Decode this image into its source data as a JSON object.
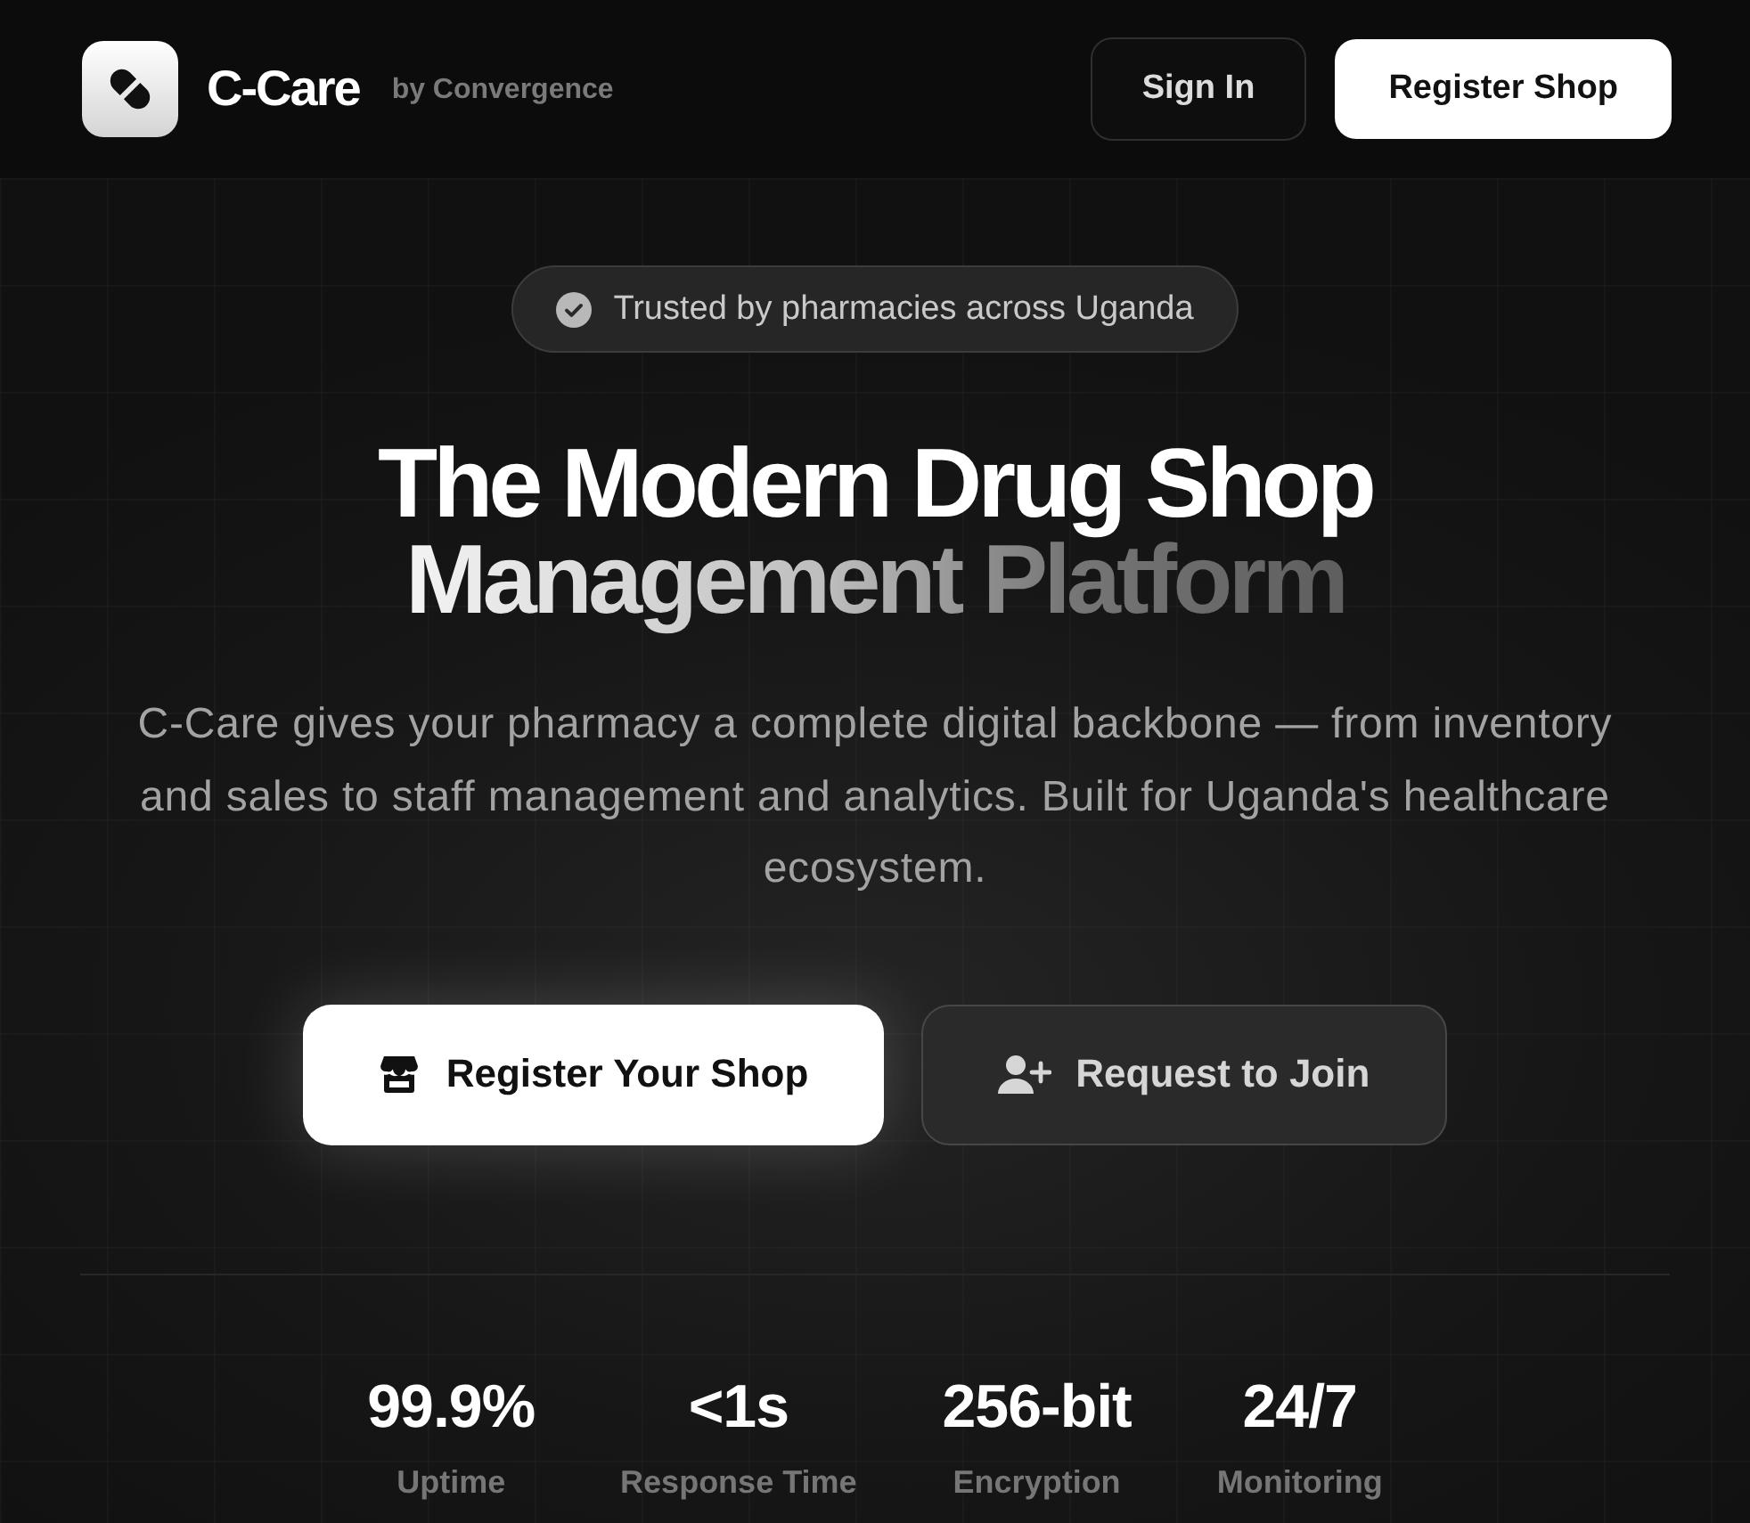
{
  "header": {
    "brand": {
      "name": "C-Care",
      "tagline": "by Convergence"
    },
    "buttons": [
      {
        "label": "Sign In",
        "kind": "outline"
      },
      {
        "label": "Register Shop",
        "kind": "primary"
      }
    ]
  },
  "hero": {
    "badge": "Trusted by pharmacies across Uganda",
    "headline": [
      "The Modern Drug Shop",
      "Management Platform"
    ],
    "description": "C-Care gives your pharmacy a complete digital backbone — from inventory and sales to staff management and analytics. Built for Uganda's healthcare ecosystem.",
    "actions": [
      {
        "label": "Register Your Shop",
        "kind": "primary"
      },
      {
        "label": "Request to Join",
        "kind": "secondary"
      }
    ]
  },
  "stats": [
    {
      "value": "99.9%",
      "label": "Uptime"
    },
    {
      "value": "<1s",
      "label": "Response Time"
    },
    {
      "value": "256-bit",
      "label": "Encryption"
    },
    {
      "value": "24/7",
      "label": "Monitoring"
    }
  ]
}
